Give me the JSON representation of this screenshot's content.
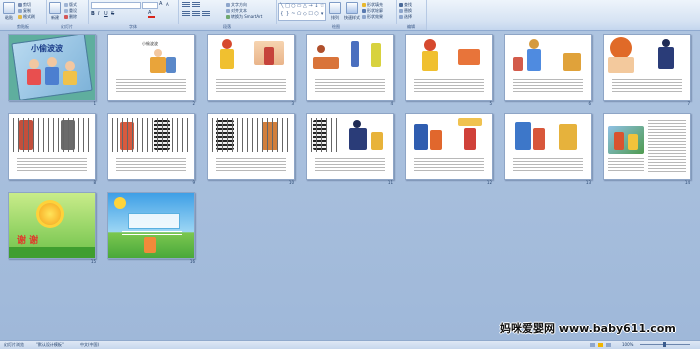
{
  "ribbon": {
    "groups": [
      {
        "key": "clipboard",
        "label": "剪贴板"
      },
      {
        "key": "slides",
        "label": "幻灯片"
      },
      {
        "key": "font",
        "label": "字体"
      },
      {
        "key": "paragraph",
        "label": "段落"
      },
      {
        "key": "drawing",
        "label": "绘图"
      },
      {
        "key": "editing",
        "label": "编辑"
      }
    ],
    "buttons": {
      "paste": "粘贴",
      "cut": "剪切",
      "copy": "复制",
      "format_painter": "格式刷",
      "new_slide": "新建",
      "new_slide2": "幻灯片",
      "layout": "版式",
      "reset": "重设",
      "delete": "删除",
      "text_direction": "文字方向",
      "align_text": "对齐文本",
      "smartart": "转换为 SmartArt",
      "arrange": "排列",
      "quick_styles": "快速样式",
      "shape_fill": "形状填充",
      "shape_outline": "形状轮廓",
      "shape_effects": "形状效果",
      "find": "查找",
      "replace": "替换",
      "select": "选择"
    },
    "font_name": "",
    "font_size": ""
  },
  "slides": [
    {
      "n": "1",
      "title": "小偷波波"
    },
    {
      "n": "2",
      "title": "小偷波波"
    },
    {
      "n": "3"
    },
    {
      "n": "4"
    },
    {
      "n": "5"
    },
    {
      "n": "6"
    },
    {
      "n": "7"
    },
    {
      "n": "8"
    },
    {
      "n": "9"
    },
    {
      "n": "10"
    },
    {
      "n": "11"
    },
    {
      "n": "12"
    },
    {
      "n": "13"
    },
    {
      "n": "14"
    },
    {
      "n": "15",
      "title": "谢 谢"
    },
    {
      "n": "16"
    }
  ],
  "status": {
    "view": "幻灯片浏览",
    "theme": "\"默认设计模板\"",
    "language": "中文(中国)",
    "zoom": "100%"
  },
  "watermark": "妈咪爱婴网 www.baby611.com"
}
